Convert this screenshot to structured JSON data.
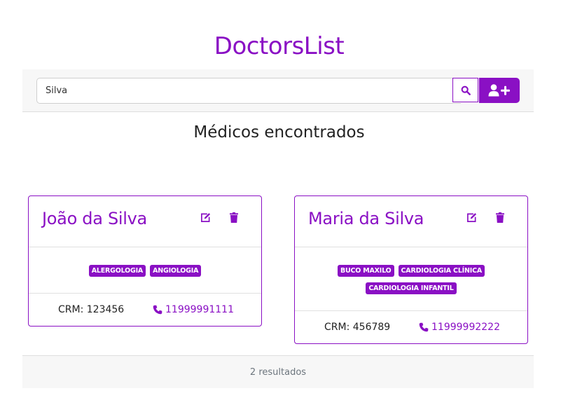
{
  "app": {
    "title": "DoctorsList"
  },
  "search": {
    "value": "Silva",
    "placeholder": ""
  },
  "section": {
    "title": "Médicos encontrados"
  },
  "colors": {
    "accent": "#8a10c4"
  },
  "doctors": [
    {
      "name": "João da Silva",
      "specialties": [
        "ALERGOLOGIA",
        "ANGIOLOGIA"
      ],
      "crm_label": "CRM: 123456",
      "phone": "11999991111"
    },
    {
      "name": "Maria da Silva",
      "specialties": [
        "BUCO MAXILO",
        "CARDIOLOGIA CLÍNICA",
        "CARDIOLOGIA INFANTIL"
      ],
      "crm_label": "CRM: 456789",
      "phone": "11999992222"
    }
  ],
  "footer": {
    "results": "2 resultados"
  },
  "icons": {
    "search": "search-icon",
    "add_user": "user-plus-icon",
    "edit": "edit-icon",
    "delete": "trash-icon",
    "phone": "phone-icon"
  }
}
